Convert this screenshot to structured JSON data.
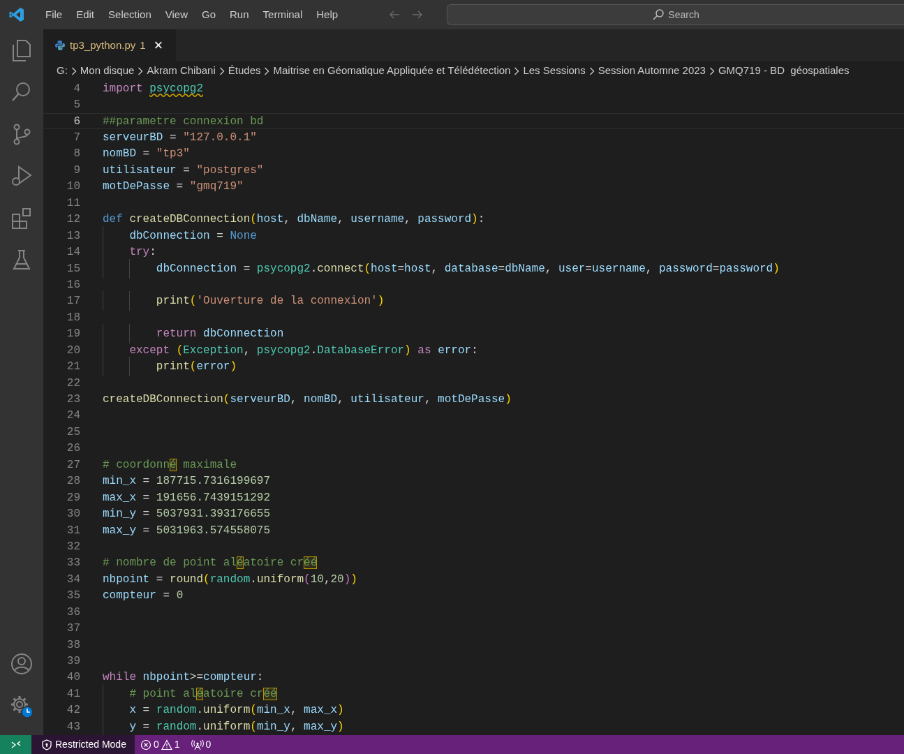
{
  "menu": [
    "File",
    "Edit",
    "Selection",
    "View",
    "Go",
    "Run",
    "Terminal",
    "Help"
  ],
  "search": {
    "placeholder": "Search"
  },
  "activity_bar": [
    {
      "kind": "explorer"
    },
    {
      "kind": "search"
    },
    {
      "kind": "source-control"
    },
    {
      "kind": "run-debug"
    },
    {
      "kind": "extensions"
    },
    {
      "kind": "testing"
    }
  ],
  "activity_bar_bottom": [
    {
      "kind": "account"
    },
    {
      "kind": "manage"
    }
  ],
  "tabs": [
    {
      "label": "tp3_python.py",
      "problems": "1",
      "close": "×",
      "selected": true
    }
  ],
  "breadcrumbs": [
    "G:",
    "Mon disque",
    "Akram Chibani",
    "Études",
    "Maitrise en Géomatique Appliquée et Télédétection",
    "Les Sessions",
    "Session Automne 2023",
    "GMQ719 - BD  géospatiales"
  ],
  "editor": {
    "lines": [
      {
        "number": "4",
        "selected": false,
        "tokens": [
          {
            "text": "import ",
            "kind": "keyword"
          },
          {
            "text": "psycopg2",
            "kind": "module-warn"
          }
        ]
      },
      {
        "number": "5",
        "selected": false
      },
      {
        "number": "6",
        "selected": true,
        "tokens": [
          {
            "text": "##parametre connexion bd",
            "kind": "comment"
          }
        ]
      },
      {
        "number": "7",
        "selected": false,
        "tokens": [
          {
            "text": "serveurBD",
            "kind": "var"
          },
          {
            "text": " = ",
            "kind": "plain"
          },
          {
            "text": "\"127.0.0.1\"",
            "kind": "string"
          }
        ]
      },
      {
        "number": "8",
        "selected": false,
        "tokens": [
          {
            "text": "nomBD",
            "kind": "var"
          },
          {
            "text": " = ",
            "kind": "plain"
          },
          {
            "text": "\"tp3\"",
            "kind": "string"
          }
        ]
      },
      {
        "number": "9",
        "selected": false,
        "tokens": [
          {
            "text": "utilisateur",
            "kind": "var"
          },
          {
            "text": " = ",
            "kind": "plain"
          },
          {
            "text": "\"postgres\"",
            "kind": "string"
          }
        ]
      },
      {
        "number": "10",
        "selected": false,
        "tokens": [
          {
            "text": "motDePasse",
            "kind": "var"
          },
          {
            "text": " = ",
            "kind": "plain"
          },
          {
            "text": "\"gmq719\"",
            "kind": "string"
          }
        ]
      },
      {
        "number": "11",
        "selected": false
      },
      {
        "number": "12",
        "selected": false,
        "tokens": [
          {
            "text": "def ",
            "kind": "storage"
          },
          {
            "text": "createDBConnection",
            "kind": "function"
          },
          {
            "text": "(",
            "kind": "paren1"
          },
          {
            "text": "host",
            "kind": "var"
          },
          {
            "text": ", ",
            "kind": "plain"
          },
          {
            "text": "dbName",
            "kind": "var"
          },
          {
            "text": ", ",
            "kind": "plain"
          },
          {
            "text": "username",
            "kind": "var"
          },
          {
            "text": ", ",
            "kind": "plain"
          },
          {
            "text": "password",
            "kind": "var"
          },
          {
            "text": ")",
            "kind": "paren1"
          },
          {
            "text": ":",
            "kind": "plain"
          }
        ]
      },
      {
        "number": "13",
        "selected": false,
        "tokens": [
          {
            "text": "    dbConnection",
            "kind": "var"
          },
          {
            "text": " = ",
            "kind": "plain"
          },
          {
            "text": "None",
            "kind": "storage"
          }
        ]
      },
      {
        "number": "14",
        "selected": false,
        "tokens": [
          {
            "text": "    try",
            "kind": "keyword"
          },
          {
            "text": ":",
            "kind": "plain"
          }
        ]
      },
      {
        "number": "15",
        "selected": false,
        "tokens": [
          {
            "text": "        dbConnection",
            "kind": "var"
          },
          {
            "text": " = ",
            "kind": "plain"
          },
          {
            "text": "psycopg2",
            "kind": "module"
          },
          {
            "text": ".",
            "kind": "plain"
          },
          {
            "text": "connect",
            "kind": "function"
          },
          {
            "text": "(",
            "kind": "paren1"
          },
          {
            "text": "host",
            "kind": "var"
          },
          {
            "text": "=",
            "kind": "plain"
          },
          {
            "text": "host",
            "kind": "var"
          },
          {
            "text": ", ",
            "kind": "plain"
          },
          {
            "text": "database",
            "kind": "var"
          },
          {
            "text": "=",
            "kind": "plain"
          },
          {
            "text": "dbName",
            "kind": "var"
          },
          {
            "text": ", ",
            "kind": "plain"
          },
          {
            "text": "user",
            "kind": "var"
          },
          {
            "text": "=",
            "kind": "plain"
          },
          {
            "text": "username",
            "kind": "var"
          },
          {
            "text": ", ",
            "kind": "plain"
          },
          {
            "text": "password",
            "kind": "var"
          },
          {
            "text": "=",
            "kind": "plain"
          },
          {
            "text": "password",
            "kind": "var"
          },
          {
            "text": ")",
            "kind": "paren1"
          }
        ]
      },
      {
        "number": "16",
        "selected": false
      },
      {
        "number": "17",
        "selected": false,
        "tokens": [
          {
            "text": "        print",
            "kind": "function"
          },
          {
            "text": "(",
            "kind": "paren1"
          },
          {
            "text": "'Ouverture de la connexion'",
            "kind": "string"
          },
          {
            "text": ")",
            "kind": "paren1"
          }
        ]
      },
      {
        "number": "18",
        "selected": false
      },
      {
        "number": "19",
        "selected": false,
        "tokens": [
          {
            "text": "        return ",
            "kind": "keyword"
          },
          {
            "text": "dbConnection",
            "kind": "var"
          }
        ]
      },
      {
        "number": "20",
        "selected": false,
        "tokens": [
          {
            "text": "    except ",
            "kind": "keyword"
          },
          {
            "text": "(",
            "kind": "paren1"
          },
          {
            "text": "Exception",
            "kind": "module"
          },
          {
            "text": ", ",
            "kind": "plain"
          },
          {
            "text": "psycopg2",
            "kind": "module"
          },
          {
            "text": ".",
            "kind": "plain"
          },
          {
            "text": "DatabaseError",
            "kind": "module"
          },
          {
            "text": ")",
            "kind": "paren1"
          },
          {
            "text": " as ",
            "kind": "keyword"
          },
          {
            "text": "error",
            "kind": "var"
          },
          {
            "text": ":",
            "kind": "plain"
          }
        ]
      },
      {
        "number": "21",
        "selected": false,
        "tokens": [
          {
            "text": "        print",
            "kind": "function"
          },
          {
            "text": "(",
            "kind": "paren1"
          },
          {
            "text": "error",
            "kind": "var"
          },
          {
            "text": ")",
            "kind": "paren1"
          }
        ]
      },
      {
        "number": "22",
        "selected": false
      },
      {
        "number": "23",
        "selected": false,
        "tokens": [
          {
            "text": "createDBConnection",
            "kind": "function"
          },
          {
            "text": "(",
            "kind": "paren1"
          },
          {
            "text": "serveurBD",
            "kind": "var"
          },
          {
            "text": ", ",
            "kind": "plain"
          },
          {
            "text": "nomBD",
            "kind": "var"
          },
          {
            "text": ", ",
            "kind": "plain"
          },
          {
            "text": "utilisateur",
            "kind": "var"
          },
          {
            "text": ", ",
            "kind": "plain"
          },
          {
            "text": "motDePasse",
            "kind": "var"
          },
          {
            "text": ")",
            "kind": "paren1"
          }
        ]
      },
      {
        "number": "24",
        "selected": false
      },
      {
        "number": "25",
        "selected": false
      },
      {
        "number": "26",
        "selected": false
      },
      {
        "number": "27",
        "selected": false,
        "tokens": [
          {
            "text": "# coordonn",
            "kind": "comment"
          },
          {
            "text": "é",
            "kind": "comment-flag"
          },
          {
            "text": " maximale",
            "kind": "comment"
          }
        ]
      },
      {
        "number": "28",
        "selected": false,
        "tokens": [
          {
            "text": "min_x",
            "kind": "var"
          },
          {
            "text": " = ",
            "kind": "plain"
          },
          {
            "text": "187715.7316199697",
            "kind": "number"
          }
        ]
      },
      {
        "number": "29",
        "selected": false,
        "tokens": [
          {
            "text": "max_x",
            "kind": "var"
          },
          {
            "text": " = ",
            "kind": "plain"
          },
          {
            "text": "191656.7439151292",
            "kind": "number"
          }
        ]
      },
      {
        "number": "30",
        "selected": false,
        "tokens": [
          {
            "text": "min_y",
            "kind": "var"
          },
          {
            "text": " = ",
            "kind": "plain"
          },
          {
            "text": "5037931.393176655",
            "kind": "number"
          }
        ]
      },
      {
        "number": "31",
        "selected": false,
        "tokens": [
          {
            "text": "max_y",
            "kind": "var"
          },
          {
            "text": " = ",
            "kind": "plain"
          },
          {
            "text": "5031963.574558075",
            "kind": "number"
          }
        ]
      },
      {
        "number": "32",
        "selected": false
      },
      {
        "number": "33",
        "selected": false,
        "tokens": [
          {
            "text": "# nombre de point al",
            "kind": "comment"
          },
          {
            "text": "é",
            "kind": "comment-flag"
          },
          {
            "text": "atoire cr",
            "kind": "comment"
          },
          {
            "text": "éé",
            "kind": "comment-flag"
          }
        ]
      },
      {
        "number": "34",
        "selected": false,
        "tokens": [
          {
            "text": "nbpoint",
            "kind": "var"
          },
          {
            "text": " = ",
            "kind": "plain"
          },
          {
            "text": "round",
            "kind": "function"
          },
          {
            "text": "(",
            "kind": "paren1"
          },
          {
            "text": "random",
            "kind": "module"
          },
          {
            "text": ".",
            "kind": "plain"
          },
          {
            "text": "uniform",
            "kind": "function"
          },
          {
            "text": "(",
            "kind": "paren2"
          },
          {
            "text": "10",
            "kind": "number"
          },
          {
            "text": ",",
            "kind": "plain"
          },
          {
            "text": "20",
            "kind": "number"
          },
          {
            "text": ")",
            "kind": "paren2"
          },
          {
            "text": ")",
            "kind": "paren1"
          }
        ]
      },
      {
        "number": "35",
        "selected": false,
        "tokens": [
          {
            "text": "compteur",
            "kind": "var"
          },
          {
            "text": " = ",
            "kind": "plain"
          },
          {
            "text": "0",
            "kind": "number"
          }
        ]
      },
      {
        "number": "36",
        "selected": false
      },
      {
        "number": "37",
        "selected": false
      },
      {
        "number": "38",
        "selected": false
      },
      {
        "number": "39",
        "selected": false
      },
      {
        "number": "40",
        "selected": false,
        "tokens": [
          {
            "text": "while ",
            "kind": "keyword"
          },
          {
            "text": "nbpoint",
            "kind": "var"
          },
          {
            "text": ">=",
            "kind": "plain"
          },
          {
            "text": "compteur",
            "kind": "var"
          },
          {
            "text": ":",
            "kind": "plain"
          }
        ]
      },
      {
        "number": "41",
        "selected": false,
        "tokens": [
          {
            "text": "    # point al",
            "kind": "comment"
          },
          {
            "text": "é",
            "kind": "comment-flag"
          },
          {
            "text": "atoire cr",
            "kind": "comment"
          },
          {
            "text": "éé",
            "kind": "comment-flag"
          }
        ]
      },
      {
        "number": "42",
        "selected": false,
        "tokens": [
          {
            "text": "    x",
            "kind": "var"
          },
          {
            "text": " = ",
            "kind": "plain"
          },
          {
            "text": "random",
            "kind": "module"
          },
          {
            "text": ".",
            "kind": "plain"
          },
          {
            "text": "uniform",
            "kind": "function"
          },
          {
            "text": "(",
            "kind": "paren1"
          },
          {
            "text": "min_x",
            "kind": "var"
          },
          {
            "text": ", ",
            "kind": "plain"
          },
          {
            "text": "max_x",
            "kind": "var"
          },
          {
            "text": ")",
            "kind": "paren1"
          }
        ]
      },
      {
        "number": "43",
        "selected": false,
        "tokens": [
          {
            "text": "    y",
            "kind": "var"
          },
          {
            "text": " = ",
            "kind": "plain"
          },
          {
            "text": "random",
            "kind": "module"
          },
          {
            "text": ".",
            "kind": "plain"
          },
          {
            "text": "uniform",
            "kind": "function"
          },
          {
            "text": "(",
            "kind": "paren1"
          },
          {
            "text": "min_y",
            "kind": "var"
          },
          {
            "text": ", ",
            "kind": "plain"
          },
          {
            "text": "max_y",
            "kind": "var"
          },
          {
            "text": ")",
            "kind": "paren1"
          }
        ]
      }
    ]
  },
  "status_bar": {
    "restricted_mode": "Restricted Mode",
    "errors": "0",
    "warnings": "1",
    "ports": "0"
  }
}
